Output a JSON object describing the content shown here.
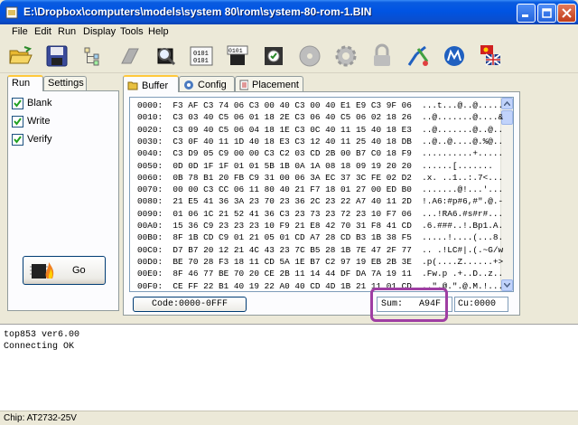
{
  "window": {
    "title": "E:\\Dropbox\\computers\\models\\system 80\\rom\\system-80-rom-1.BIN",
    "buttons": [
      "minimize",
      "maximize",
      "close"
    ]
  },
  "menu": {
    "items": [
      "File",
      "Edit",
      "Run",
      "Display",
      "Tools",
      "Help"
    ]
  },
  "toolbar": {
    "icons": [
      "open-folder-icon",
      "save-disk-icon",
      "tree-icon",
      "erase-icon",
      "search-chip-icon",
      "compare-icon",
      "chip-binary-icon",
      "verify-chip-icon",
      "burn-disc-icon",
      "gear-icon",
      "lock-icon",
      "config-tool-icon",
      "motorola-icon",
      "language-flag-icon"
    ]
  },
  "left_panel": {
    "tabs": [
      "Run",
      "Settings"
    ],
    "active_tab": "Run",
    "options": [
      {
        "label": "Blank",
        "checked": true
      },
      {
        "label": "Write",
        "checked": true
      },
      {
        "label": "Verify",
        "checked": true
      }
    ],
    "go_label": "Go"
  },
  "right_panel": {
    "tabs": [
      "Buffer",
      "Config",
      "Placement"
    ],
    "active_tab": "Buffer",
    "hex_rows": [
      {
        "addr": "0000:",
        "bytes": "F3 AF C3 74 06 C3 00 40 C3 00 40 E1 E9 C3 9F 06",
        "ascii": "...t...@..@....."
      },
      {
        "addr": "0010:",
        "bytes": "C3 03 40 C5 06 01 18 2E C3 06 40 C5 06 02 18 26",
        "ascii": "..@.......@....&"
      },
      {
        "addr": "0020:",
        "bytes": "C3 09 40 C5 06 04 18 1E C3 0C 40 11 15 40 18 E3",
        "ascii": "..@.......@..@.."
      },
      {
        "addr": "0030:",
        "bytes": "C3 0F 40 11 1D 40 18 E3 C3 12 40 11 25 40 18 DB",
        "ascii": "..@..@....@.%@.."
      },
      {
        "addr": "0040:",
        "bytes": "C3 D9 05 C9 00 00 C3 C2 03 CD 2B 00 B7 C0 18 F9",
        "ascii": "..........+....."
      },
      {
        "addr": "0050:",
        "bytes": "0D 0D 1F 1F 01 01 5B 1B 0A 1A 08 18 09 19 20 20",
        "ascii": "......[.......  "
      },
      {
        "addr": "0060:",
        "bytes": "0B 78 B1 20 FB C9 31 00 06 3A EC 37 3C FE 02 D2",
        "ascii": ".x. ..1..:.7<..."
      },
      {
        "addr": "0070:",
        "bytes": "00 00 C3 CC 06 11 80 40 21 F7 18 01 27 00 ED B0",
        "ascii": ".......@!...'..."
      },
      {
        "addr": "0080:",
        "bytes": "21 E5 41 36 3A 23 70 23 36 2C 23 22 A7 40 11 2D",
        "ascii": "!.A6:#p#6,#\".@.-"
      },
      {
        "addr": "0090:",
        "bytes": "01 06 1C 21 52 41 36 C3 23 73 23 72 23 10 F7 06",
        "ascii": "...!RA6.#s#r#..."
      },
      {
        "addr": "00A0:",
        "bytes": "15 36 C9 23 23 23 10 F9 21 E8 42 70 31 F8 41 CD",
        "ascii": ".6.###..!.Bp1.A."
      },
      {
        "addr": "00B0:",
        "bytes": "8F 1B CD C9 01 21 05 01 CD A7 28 CD B3 1B 38 F5",
        "ascii": ".....!....(...8."
      },
      {
        "addr": "00C0:",
        "bytes": "D7 B7 20 12 21 4C 43 23 7C B5 28 1B 7E 47 2F 77",
        "ascii": ".. .!LC#|.(.~G/w"
      },
      {
        "addr": "00D0:",
        "bytes": "BE 70 28 F3 18 11 CD 5A 1E B7 C2 97 19 EB 2B 3E",
        "ascii": ".p(....Z......+>"
      },
      {
        "addr": "00E0:",
        "bytes": "8F 46 77 BE 70 20 CE 2B 11 14 44 DF DA 7A 19 11",
        "ascii": ".Fw.p .+..D..z.."
      },
      {
        "addr": "00F0:",
        "bytes": "CE FF 22 B1 40 19 22 A0 40 CD 4D 1B 21 11 01 CD",
        "ascii": "..\".@.\".@.M.!..."
      }
    ],
    "code_label": "Code:0000-0FFF",
    "sum_label": "Sum:",
    "sum_value": "A94F",
    "cu_label": "Cu:0000"
  },
  "log": {
    "lines": [
      "top853 ver6.00",
      "Connecting OK"
    ]
  },
  "status": {
    "chip": "Chip: AT2732-25V"
  },
  "colors": {
    "titlebar": "#0054e3",
    "highlight": "#9f3ea3",
    "panel": "#ece9d8"
  }
}
